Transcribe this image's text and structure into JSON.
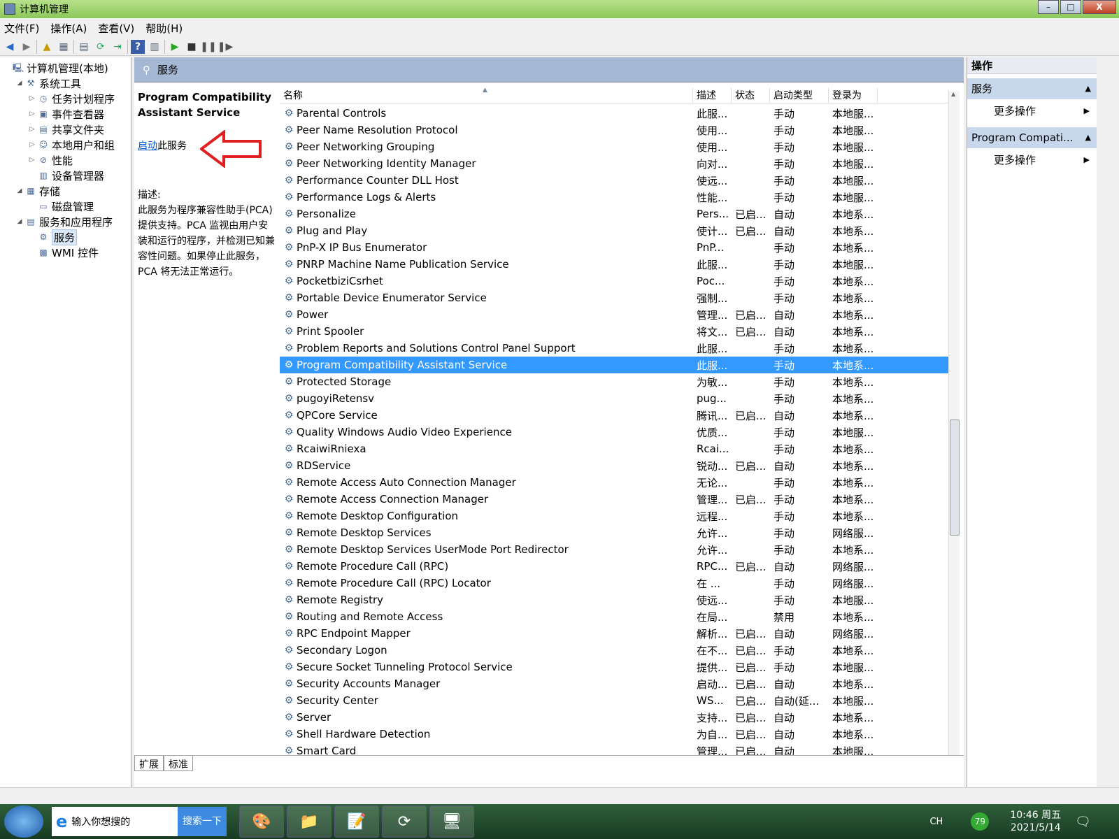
{
  "window": {
    "title": "计算机管理",
    "min": "–",
    "max": "□",
    "close": "X"
  },
  "menu": [
    "文件(F)",
    "操作(A)",
    "查看(V)",
    "帮助(H)"
  ],
  "tree": [
    {
      "label": "计算机管理(本地)",
      "level": 0,
      "arrow": "",
      "icon": "computer-icon"
    },
    {
      "label": "系统工具",
      "level": 1,
      "arrow": "◢",
      "icon": "tools-icon"
    },
    {
      "label": "任务计划程序",
      "level": 2,
      "arrow": "▷",
      "icon": "clock-icon"
    },
    {
      "label": "事件查看器",
      "level": 2,
      "arrow": "▷",
      "icon": "event-viewer-icon"
    },
    {
      "label": "共享文件夹",
      "level": 2,
      "arrow": "▷",
      "icon": "shared-folder-icon"
    },
    {
      "label": "本地用户和组",
      "level": 2,
      "arrow": "▷",
      "icon": "users-icon"
    },
    {
      "label": "性能",
      "level": 2,
      "arrow": "▷",
      "icon": "performance-icon"
    },
    {
      "label": "设备管理器",
      "level": 2,
      "arrow": "",
      "icon": "device-manager-icon"
    },
    {
      "label": "存储",
      "level": 1,
      "arrow": "◢",
      "icon": "storage-icon"
    },
    {
      "label": "磁盘管理",
      "level": 2,
      "arrow": "",
      "icon": "disk-icon"
    },
    {
      "label": "服务和应用程序",
      "level": 1,
      "arrow": "◢",
      "icon": "services-apps-icon"
    },
    {
      "label": "服务",
      "level": 2,
      "arrow": "",
      "icon": "gear-icon",
      "selected": true
    },
    {
      "label": "WMI 控件",
      "level": 2,
      "arrow": "",
      "icon": "wmi-icon"
    }
  ],
  "center": {
    "heading": "服务",
    "desc": {
      "service_name": "Program Compatibility Assistant Service",
      "start_link": "启动",
      "start_suffix": "此服务",
      "desc_label": "描述:",
      "desc_text": "此服务为程序兼容性助手(PCA)提供支持。PCA 监视由用户安装和运行的程序，并检测已知兼容性问题。如果停止此服务，PCA 将无法正常运行。"
    },
    "columns": [
      "名称",
      "描述",
      "状态",
      "启动类型",
      "登录为"
    ],
    "rows": [
      [
        "Parental Controls",
        "此服...",
        "",
        "手动",
        "本地服..."
      ],
      [
        "Peer Name Resolution Protocol",
        "使用...",
        "",
        "手动",
        "本地服..."
      ],
      [
        "Peer Networking Grouping",
        "使用...",
        "",
        "手动",
        "本地服..."
      ],
      [
        "Peer Networking Identity Manager",
        "向对...",
        "",
        "手动",
        "本地服..."
      ],
      [
        "Performance Counter DLL Host",
        "使远...",
        "",
        "手动",
        "本地服..."
      ],
      [
        "Performance Logs & Alerts",
        "性能...",
        "",
        "手动",
        "本地服..."
      ],
      [
        "Personalize",
        "Pers...",
        "已启...",
        "自动",
        "本地系..."
      ],
      [
        "Plug and Play",
        "使计...",
        "已启...",
        "自动",
        "本地系..."
      ],
      [
        "PnP-X IP Bus Enumerator",
        "PnP...",
        "",
        "手动",
        "本地系..."
      ],
      [
        "PNRP Machine Name Publication Service",
        "此服...",
        "",
        "手动",
        "本地服..."
      ],
      [
        "PocketbiziCsrhet",
        "Poc...",
        "",
        "手动",
        "本地系..."
      ],
      [
        "Portable Device Enumerator Service",
        "强制...",
        "",
        "手动",
        "本地系..."
      ],
      [
        "Power",
        "管理...",
        "已启...",
        "自动",
        "本地系..."
      ],
      [
        "Print Spooler",
        "将文...",
        "已启...",
        "自动",
        "本地系..."
      ],
      [
        "Problem Reports and Solutions Control Panel Support",
        "此服...",
        "",
        "手动",
        "本地系..."
      ],
      [
        "Program Compatibility Assistant Service",
        "此服...",
        "",
        "手动",
        "本地系..."
      ],
      [
        "Protected Storage",
        "为敏...",
        "",
        "手动",
        "本地系..."
      ],
      [
        "pugoyiRetensv",
        "pug...",
        "",
        "手动",
        "本地系..."
      ],
      [
        "QPCore Service",
        "腾讯...",
        "已启...",
        "自动",
        "本地系..."
      ],
      [
        "Quality Windows Audio Video Experience",
        "优质...",
        "",
        "手动",
        "本地服..."
      ],
      [
        "RcaiwiRniexa",
        "Rcai...",
        "",
        "手动",
        "本地系..."
      ],
      [
        "RDService",
        "锐动...",
        "已启...",
        "自动",
        "本地系..."
      ],
      [
        "Remote Access Auto Connection Manager",
        "无论...",
        "",
        "手动",
        "本地系..."
      ],
      [
        "Remote Access Connection Manager",
        "管理...",
        "已启...",
        "手动",
        "本地系..."
      ],
      [
        "Remote Desktop Configuration",
        "远程...",
        "",
        "手动",
        "本地系..."
      ],
      [
        "Remote Desktop Services",
        "允许...",
        "",
        "手动",
        "网络服..."
      ],
      [
        "Remote Desktop Services UserMode Port Redirector",
        "允许...",
        "",
        "手动",
        "本地系..."
      ],
      [
        "Remote Procedure Call (RPC)",
        "RPC...",
        "已启...",
        "自动",
        "网络服..."
      ],
      [
        "Remote Procedure Call (RPC) Locator",
        "在 ...",
        "",
        "手动",
        "网络服..."
      ],
      [
        "Remote Registry",
        "使远...",
        "",
        "手动",
        "本地服..."
      ],
      [
        "Routing and Remote Access",
        "在局...",
        "",
        "禁用",
        "本地系..."
      ],
      [
        "RPC Endpoint Mapper",
        "解析...",
        "已启...",
        "自动",
        "网络服..."
      ],
      [
        "Secondary Logon",
        "在不...",
        "已启...",
        "手动",
        "本地系..."
      ],
      [
        "Secure Socket Tunneling Protocol Service",
        "提供...",
        "已启...",
        "手动",
        "本地服..."
      ],
      [
        "Security Accounts Manager",
        "启动...",
        "已启...",
        "自动",
        "本地系..."
      ],
      [
        "Security Center",
        "WS...",
        "已启...",
        "自动(延...",
        "本地服..."
      ],
      [
        "Server",
        "支持...",
        "已启...",
        "自动",
        "本地系..."
      ],
      [
        "Shell Hardware Detection",
        "为自...",
        "已启...",
        "自动",
        "本地系..."
      ],
      [
        "Smart Card",
        "管理...",
        "已启...",
        "自动",
        "本地服..."
      ]
    ],
    "selected_row": 15,
    "tabs": [
      "扩展",
      "标准"
    ]
  },
  "actions": {
    "title": "操作",
    "sections": [
      {
        "label": "服务",
        "item": "更多操作"
      },
      {
        "label": "Program Compati...",
        "item": "更多操作"
      }
    ]
  },
  "taskbar": {
    "search_placeholder": "输入你想搜的",
    "search_button": "搜索一下",
    "lang": "CH",
    "time": "10:46 周五",
    "date": "2021/5/14",
    "badge": "79"
  },
  "colors": {
    "selection": "#3399ff",
    "annotation_arrow": "#e02020"
  }
}
